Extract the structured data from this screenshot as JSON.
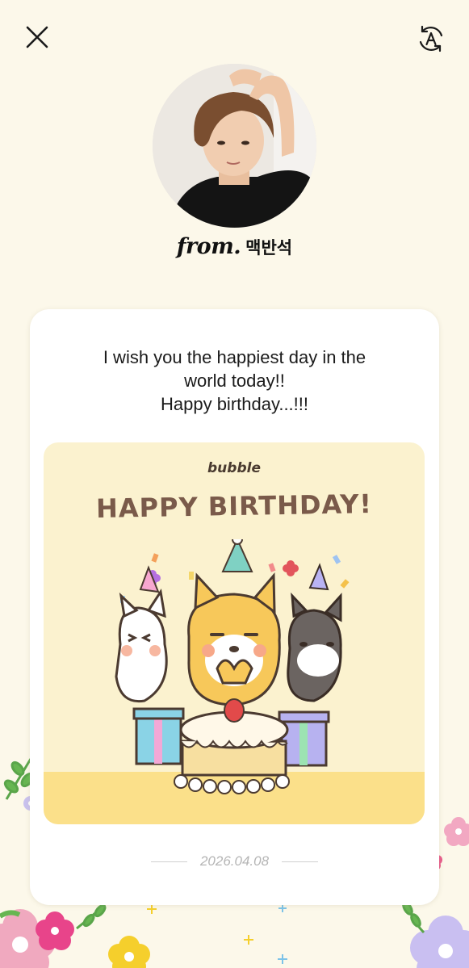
{
  "topbar": {
    "close_icon": "close-icon",
    "translate_icon": "translate-icon"
  },
  "sender": {
    "from_label": "from.",
    "name": "맥반석"
  },
  "letter": {
    "message_lines": [
      "I wish you the happiest day in the",
      "world today!!",
      "Happy birthday...!!!"
    ],
    "card_brand": "bubble",
    "card_title": "HAPPY BIRTHDAY!",
    "date": "2026.04.08"
  },
  "colors": {
    "background": "#fcf8ea",
    "card": "#ffffff",
    "birthday_card_bg": "#fbf2cf",
    "title_brown": "#7a5a4a"
  }
}
